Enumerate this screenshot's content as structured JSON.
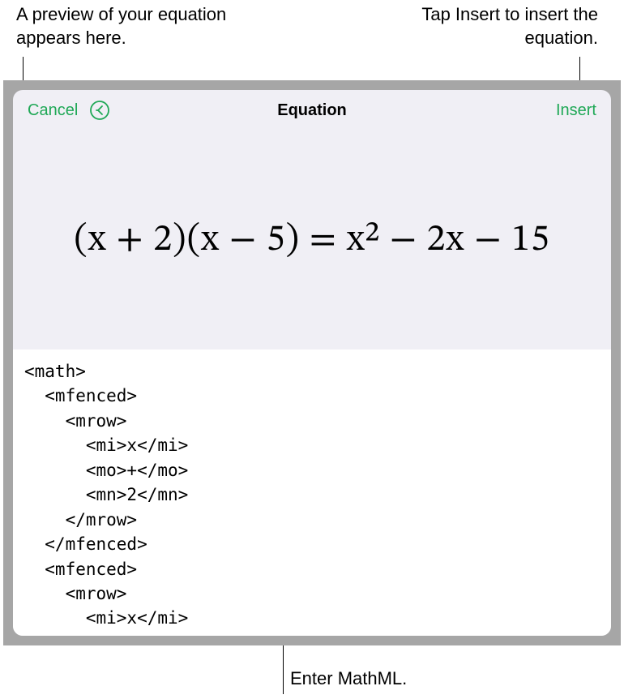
{
  "annotations": {
    "preview": "A preview of your equation appears here.",
    "insert": "Tap Insert to insert the equation.",
    "mathml": "Enter MathML."
  },
  "dialog": {
    "title": "Equation",
    "cancel_label": "Cancel",
    "insert_label": "Insert"
  },
  "preview": {
    "equation": "(x + 2)(x − 5) = x² − 2x − 15"
  },
  "input": {
    "mathml_code": "<math>\n  <mfenced>\n    <mrow>\n      <mi>x</mi>\n      <mo>+</mo>\n      <mn>2</mn>\n    </mrow>\n  </mfenced>\n  <mfenced>\n    <mrow>\n      <mi>x</mi>\n      <mo>-</mo>"
  }
}
